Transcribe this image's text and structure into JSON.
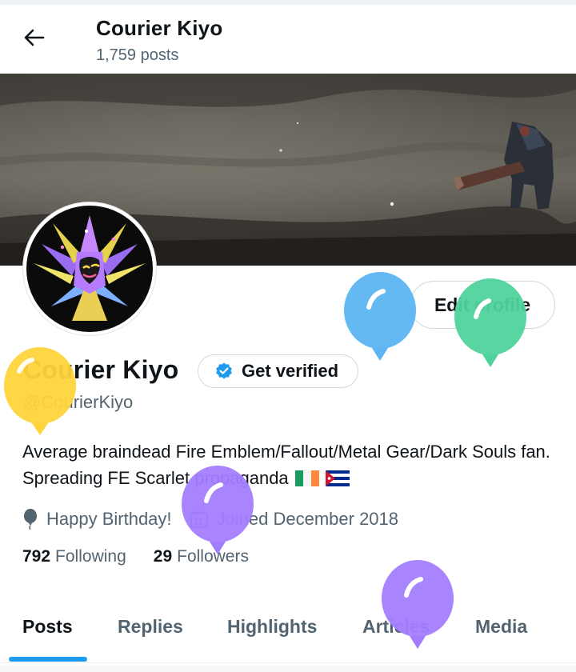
{
  "header": {
    "display_name": "Courier Kiyo",
    "posts_count": "1,759 posts"
  },
  "profile": {
    "display_name": "Courier Kiyo",
    "handle": "@CourierKiyo",
    "verified_label": "Get verified",
    "edit_label": "Edit profile",
    "bio": "Average braindead Fire Emblem/Fallout/Metal Gear/Dark Souls fan. Spreading FE Scarlet propaganda",
    "birthday": "Happy Birthday!",
    "joined": "Joined December 2018",
    "following_count": "792",
    "following_label": "Following",
    "followers_count": "29",
    "followers_label": "Followers"
  },
  "tabs": [
    {
      "label": "Posts",
      "active": true
    },
    {
      "label": "Replies"
    },
    {
      "label": "Highlights"
    },
    {
      "label": "Articles"
    },
    {
      "label": "Media"
    }
  ],
  "icons": {
    "back": "arrow-left-icon",
    "verified_badge": "verified-badge-icon",
    "birthday": "balloon-icon",
    "calendar": "calendar-icon",
    "flags": [
      "ireland-flag-icon",
      "cuba-flag-icon"
    ]
  },
  "colors": {
    "accent": "#1d9bf0",
    "text_primary": "#0f1419",
    "text_secondary": "#536471",
    "border": "#cfd9de",
    "balloons": [
      "#ffd43b",
      "#5cb5f2",
      "#4fd39c",
      "#a47dff",
      "#a47dff"
    ]
  }
}
